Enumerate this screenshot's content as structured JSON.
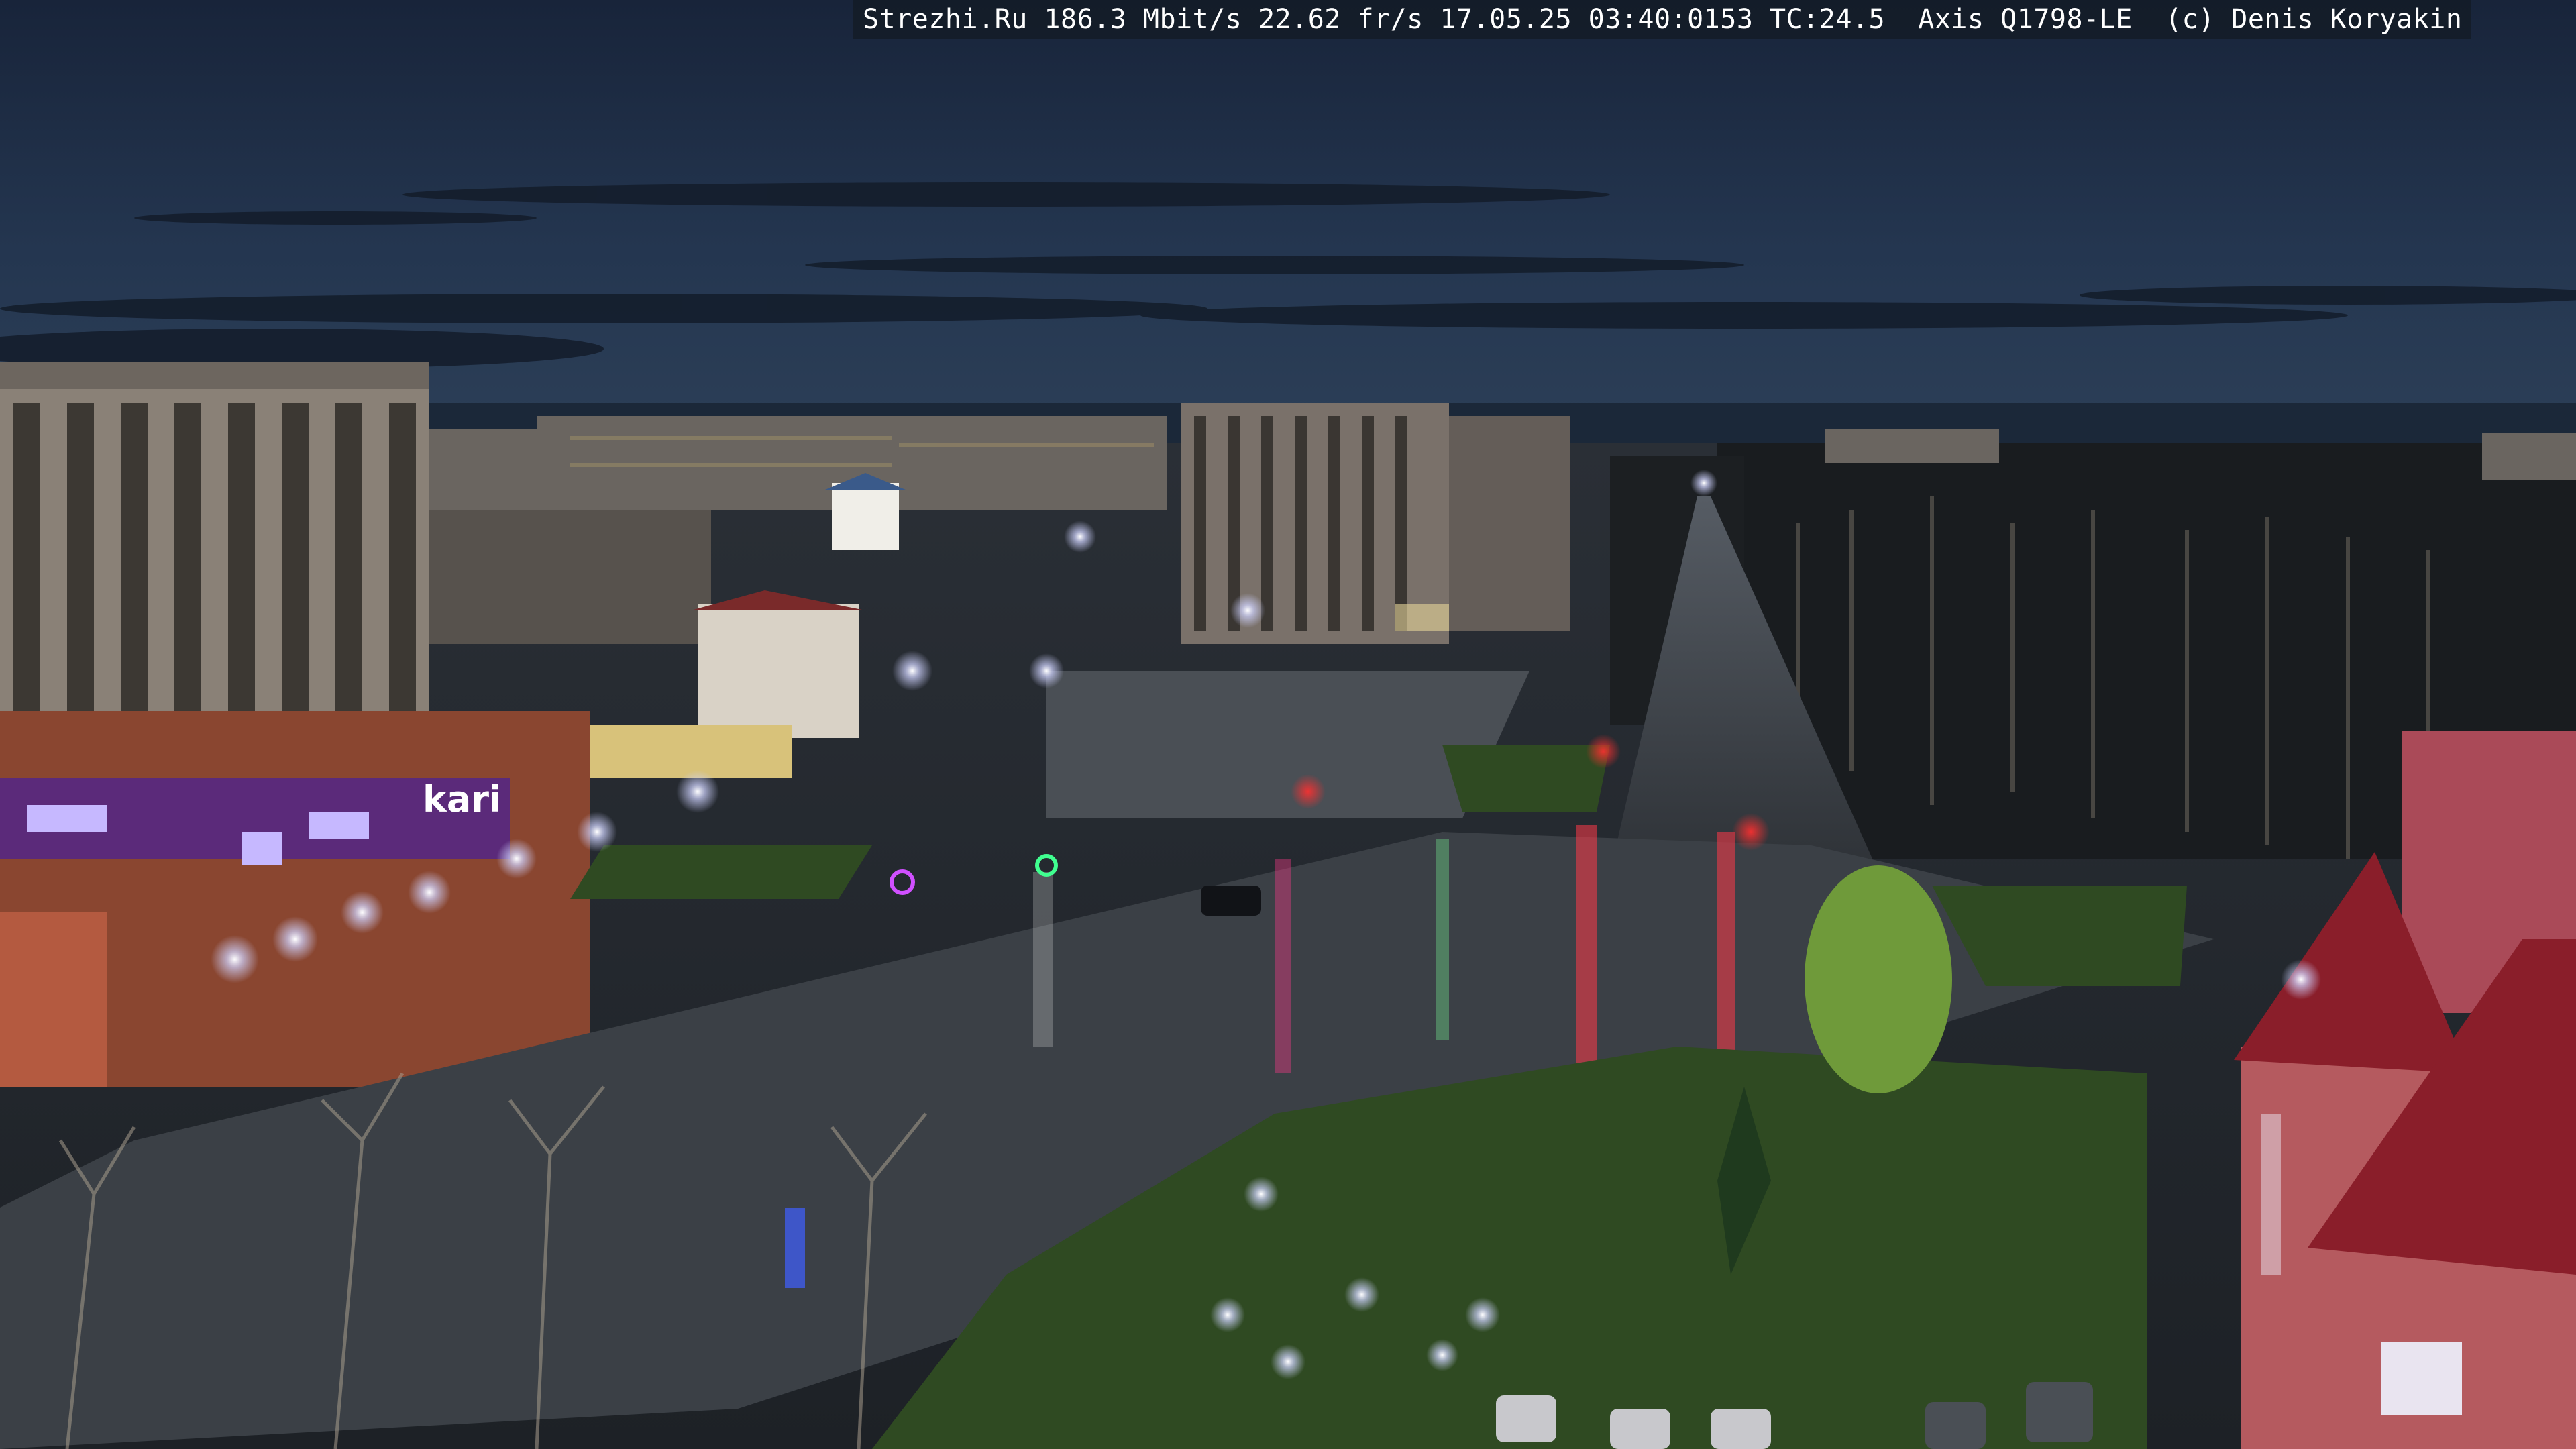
{
  "camera_overlay": {
    "text": "Strezhi.Ru 186.3 Mbit/s 22.62 fr/s 17.05.25 03:40:0153 TC:24.5  Axis Q1798-LE  (c) Denis Koryakin"
  },
  "scene": {
    "sky_top": "#1b2940",
    "sky_mid": "#24344d",
    "horizon": "#30445c",
    "pavement_wet": "#3d4249",
    "grass": "#2f4a22",
    "streetlight_glow": "#d9dcff",
    "traffic_red": "#ff2a2a",
    "facade_pink": "#b84f5f",
    "sign_purple": "#5b2a7a"
  },
  "signage": {
    "kari_sign": "kari"
  }
}
